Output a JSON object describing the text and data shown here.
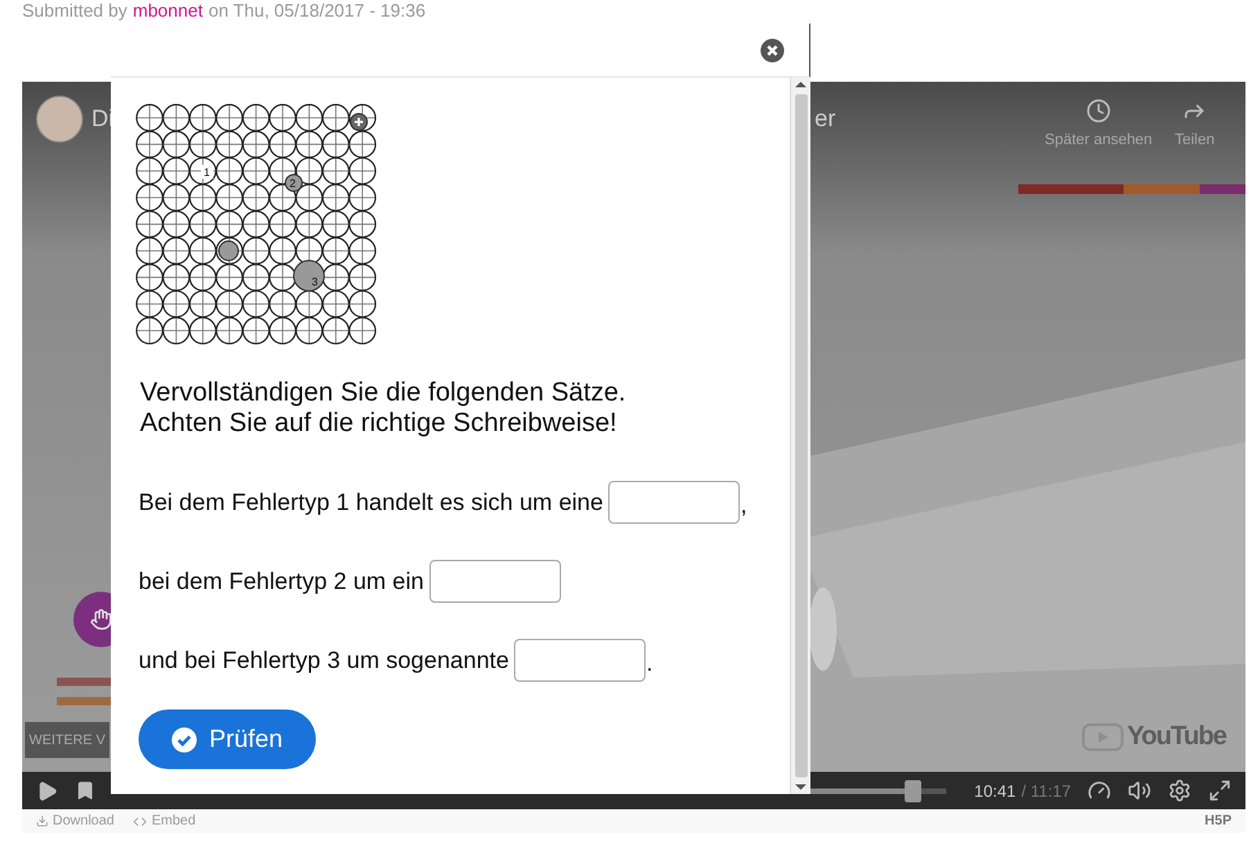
{
  "submitted": {
    "prefix": "Submitted by",
    "author": "mbonnet",
    "suffix": "on Thu, 05/18/2017 - 19:36"
  },
  "video": {
    "kind": "picture",
    "title_parts": [
      "Di",
      "er"
    ],
    "actions": [
      {
        "kind": "clock",
        "label": "Später ansehen"
      },
      {
        "kind": "share",
        "label": "Teilen"
      }
    ],
    "more_button": "WEITERE V",
    "logo": "YouTube"
  },
  "dialog": {
    "image": {
      "labels": [
        {
          "text": "1",
          "kind": "plain"
        },
        {
          "text": "2",
          "kind": "small"
        },
        {
          "text": "3",
          "kind": "large"
        }
      ]
    },
    "heading": [
      "Vervollständigen Sie die folgenden Sätze.",
      "Achten Sie auf die richtige Schreibweise!"
    ],
    "sentences": [
      {
        "text": "Bei dem Fehlertyp 1 handelt es sich um eine",
        "after": ","
      },
      {
        "text": "bei dem Fehlertyp 2 um ein"
      },
      {
        "text": "und bei Fehlertyp 3 um sogenannte",
        "after": "."
      }
    ],
    "check_button": "Prüfen"
  },
  "player": {
    "level": 0.96,
    "elapsed": "10:41",
    "duration": "/ 11:17"
  },
  "footer": {
    "links": [
      {
        "kind": "download",
        "label": "Download"
      },
      {
        "kind": "embed",
        "label": "Embed"
      }
    ],
    "logo": "H5P"
  }
}
